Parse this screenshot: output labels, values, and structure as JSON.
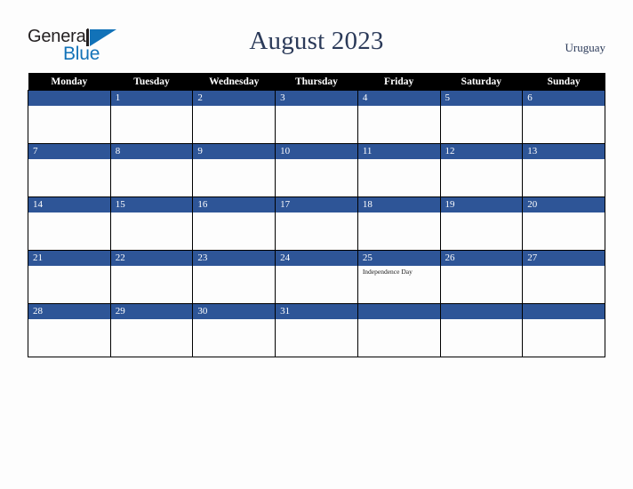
{
  "brand": {
    "name_part1": "General",
    "name_part2": "Blue",
    "mark_icon": "triangle-flag-icon",
    "color_dark": "#231f20",
    "color_blue": "#1272b8"
  },
  "header": {
    "title": "August 2023",
    "country": "Uruguay"
  },
  "calendar": {
    "accent_color": "#2e5597",
    "header_bg": "#000000",
    "weekdays": [
      "Monday",
      "Tuesday",
      "Wednesday",
      "Thursday",
      "Friday",
      "Saturday",
      "Sunday"
    ],
    "weeks": [
      [
        {
          "day": "",
          "events": []
        },
        {
          "day": "1",
          "events": []
        },
        {
          "day": "2",
          "events": []
        },
        {
          "day": "3",
          "events": []
        },
        {
          "day": "4",
          "events": []
        },
        {
          "day": "5",
          "events": []
        },
        {
          "day": "6",
          "events": []
        }
      ],
      [
        {
          "day": "7",
          "events": []
        },
        {
          "day": "8",
          "events": []
        },
        {
          "day": "9",
          "events": []
        },
        {
          "day": "10",
          "events": []
        },
        {
          "day": "11",
          "events": []
        },
        {
          "day": "12",
          "events": []
        },
        {
          "day": "13",
          "events": []
        }
      ],
      [
        {
          "day": "14",
          "events": []
        },
        {
          "day": "15",
          "events": []
        },
        {
          "day": "16",
          "events": []
        },
        {
          "day": "17",
          "events": []
        },
        {
          "day": "18",
          "events": []
        },
        {
          "day": "19",
          "events": []
        },
        {
          "day": "20",
          "events": []
        }
      ],
      [
        {
          "day": "21",
          "events": []
        },
        {
          "day": "22",
          "events": []
        },
        {
          "day": "23",
          "events": []
        },
        {
          "day": "24",
          "events": []
        },
        {
          "day": "25",
          "events": [
            "Independence Day"
          ]
        },
        {
          "day": "26",
          "events": []
        },
        {
          "day": "27",
          "events": []
        }
      ],
      [
        {
          "day": "28",
          "events": []
        },
        {
          "day": "29",
          "events": []
        },
        {
          "day": "30",
          "events": []
        },
        {
          "day": "31",
          "events": []
        },
        {
          "day": "",
          "events": []
        },
        {
          "day": "",
          "events": []
        },
        {
          "day": "",
          "events": []
        }
      ]
    ]
  }
}
